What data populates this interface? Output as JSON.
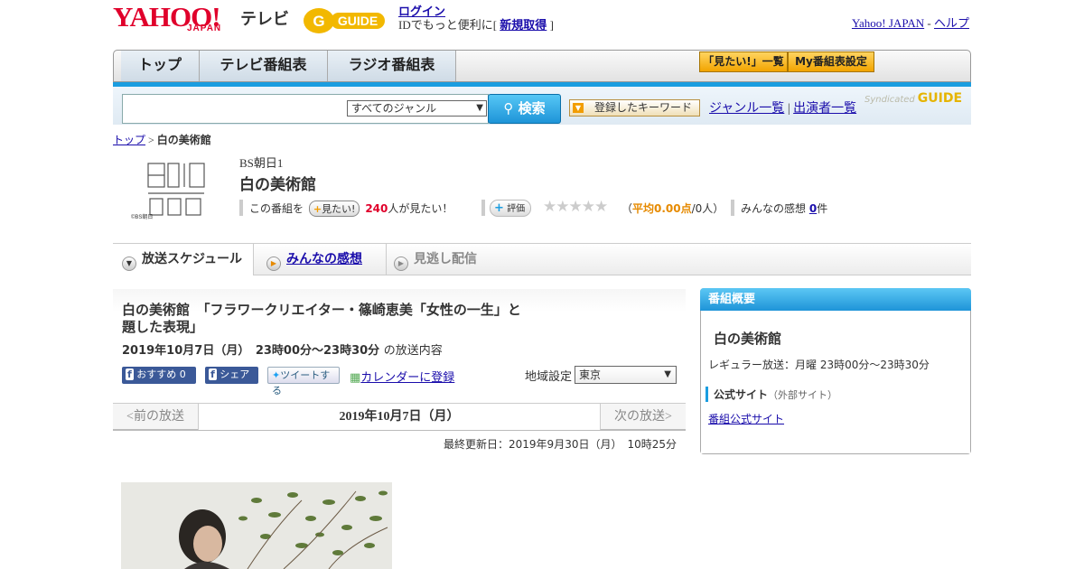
{
  "header": {
    "yahoo": "YAHOO!",
    "japan": "JAPAN",
    "tv": "テレビ",
    "gguide": "GUIDE",
    "login": "ログイン",
    "login_sub_prefix": "IDでもっと便利に[",
    "signup": "新規取得",
    "login_sub_suffix": "]",
    "yahoo_japan": "Yahoo! JAPAN",
    "sep": " - ",
    "help": "ヘルプ"
  },
  "nav": {
    "tabs": [
      "トップ",
      "テレビ番組表",
      "ラジオ番組表"
    ],
    "mitai_list": "「見たい!」一覧",
    "my_bangumi": "My番組表設定"
  },
  "search": {
    "genre": "すべてのジャンル",
    "button": "検索",
    "keyword_btn": "登録したキーワード",
    "genre_list": "ジャンル一覧",
    "divider": "|",
    "performer_list": "出演者一覧",
    "syndicated": "Syndicated"
  },
  "breadcrumb": {
    "top": "トップ",
    "sep": " > ",
    "current": "白の美術館"
  },
  "program": {
    "logo_text": "©BS朝日",
    "channel": "BS朝日1",
    "title": "白の美術館",
    "mitai_prefix": "この番組を",
    "mitai_btn": "見たい!",
    "mitai_count": "240",
    "mitai_suffix": "人が見たい！",
    "hyoka": "評価",
    "stars": "★★★★★",
    "rating_open": "（",
    "avg_label": "平均0.00点",
    "avg_people": "/0人）",
    "kansou_label": "みんなの感想",
    "kansou_count": "0",
    "kansou_unit": "件"
  },
  "subtabs": {
    "schedule": "放送スケジュール",
    "minna": "みんなの感想",
    "minogashi": "見逃し配信"
  },
  "episode": {
    "title": "白の美術館　「フラワークリエイター・篠崎恵美「女性の一生」と題した表現」",
    "date": "2019年10月7日（月）　23時00分～23時30分",
    "date_suffix": "の放送内容",
    "osusume": "おすすめ 0",
    "share": "シェア",
    "tweet": "ツイートする",
    "calendar": "カレンダーに登録",
    "region_label": "地域設定",
    "region_value": "東京",
    "prev": "<前の放送",
    "current_date": "2019年10月7日（月）",
    "next": "次の放送>",
    "updated": "最終更新日：2019年9月30日（月）　10時25分"
  },
  "sidebar": {
    "header": "番組概要",
    "title": "白の美術館",
    "regular": "レギュラー放送：月曜 23時00分～23時30分",
    "official": "公式サイト",
    "external": "（外部サイト）",
    "official_link": "番組公式サイト"
  },
  "colors": {
    "accent": "#1a9de0",
    "brand_red": "#e0002b",
    "gguide_yellow": "#f2b800"
  }
}
